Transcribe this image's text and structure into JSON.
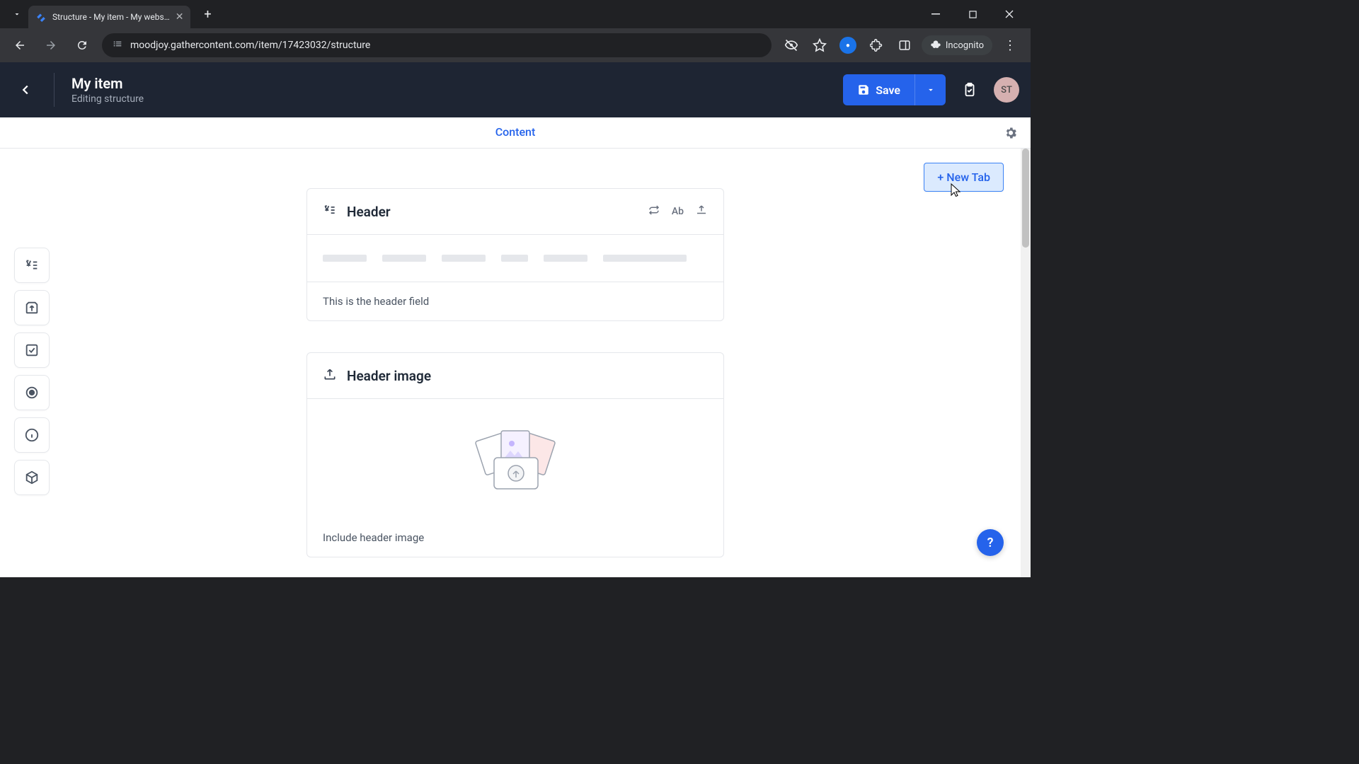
{
  "browser": {
    "tab_title": "Structure - My item - My webs…",
    "url": "moodjoy.gathercontent.com/item/17423032/structure",
    "incognito_label": "Incognito"
  },
  "header": {
    "title": "My item",
    "subtitle": "Editing structure",
    "save_label": "Save",
    "avatar_initials": "ST"
  },
  "tabs": {
    "active": "Content",
    "new_tab_label": "+ New Tab"
  },
  "fields": [
    {
      "type": "text",
      "title": "Header",
      "description": "This is the header field"
    },
    {
      "type": "attachment",
      "title": "Header image",
      "description": "Include header image"
    }
  ],
  "help_label": "?"
}
